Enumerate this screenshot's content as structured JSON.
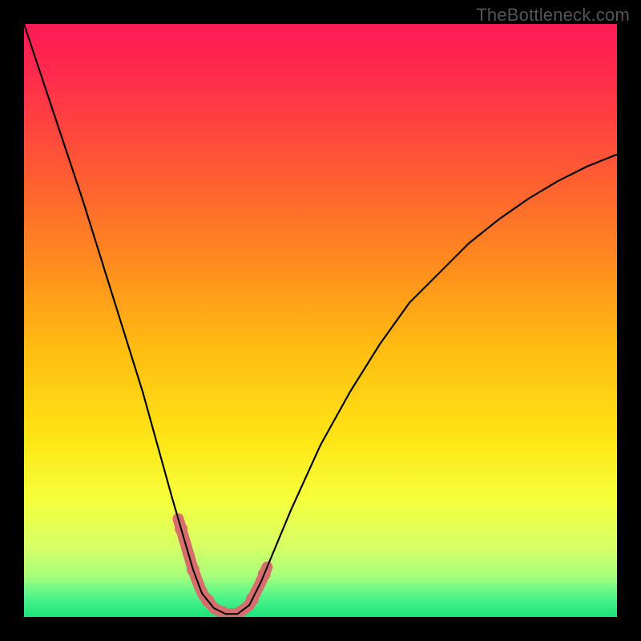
{
  "watermark": "TheBottleneck.com",
  "colors": {
    "frame": "#000000",
    "curve": "#000000",
    "highlight": "#d76e6e",
    "gradient_stops": [
      {
        "offset": 0.0,
        "color": "#ff1a55"
      },
      {
        "offset": 0.1,
        "color": "#ff2f4a"
      },
      {
        "offset": 0.25,
        "color": "#ff5a33"
      },
      {
        "offset": 0.4,
        "color": "#ff8a1f"
      },
      {
        "offset": 0.55,
        "color": "#ffbd10"
      },
      {
        "offset": 0.7,
        "color": "#ffe516"
      },
      {
        "offset": 0.8,
        "color": "#f6ff3a"
      },
      {
        "offset": 0.88,
        "color": "#d8ff66"
      },
      {
        "offset": 0.93,
        "color": "#a9ff7a"
      },
      {
        "offset": 0.965,
        "color": "#53f58a"
      },
      {
        "offset": 1.0,
        "color": "#18e47a"
      }
    ]
  },
  "chart_data": {
    "type": "line",
    "title": "",
    "xlabel": "",
    "ylabel": "",
    "xlim": [
      0,
      100
    ],
    "ylim": [
      0,
      100
    ],
    "grid": false,
    "series": [
      {
        "name": "bottleneck-curve",
        "x": [
          0,
          5,
          10,
          15,
          20,
          25,
          28.5,
          30,
          32,
          34,
          36,
          38,
          40,
          45,
          50,
          55,
          60,
          65,
          70,
          75,
          80,
          85,
          90,
          95,
          100
        ],
        "y": [
          100,
          85,
          70,
          54,
          38,
          20,
          8,
          4,
          1.5,
          0.5,
          0.5,
          2,
          6,
          18,
          29,
          38,
          46,
          53,
          58,
          63,
          67,
          70.5,
          73.5,
          76,
          78
        ]
      }
    ],
    "annotations": [
      {
        "name": "highlighted-segment",
        "x_range": [
          26,
          41
        ],
        "note": "coral rounded ticks near trough"
      }
    ]
  }
}
